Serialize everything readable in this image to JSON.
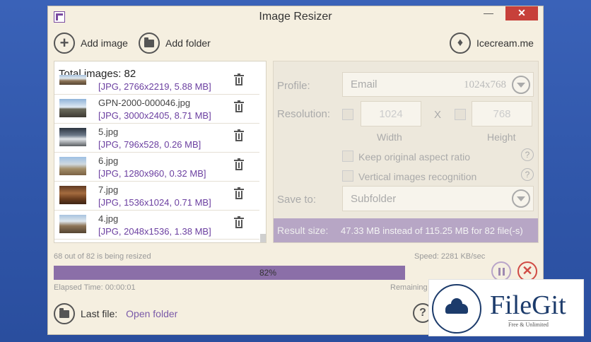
{
  "window": {
    "title": "Image Resizer",
    "minimize_glyph": "—",
    "close_glyph": "✕"
  },
  "toolbar": {
    "add_image": "Add image",
    "add_folder": "Add folder",
    "icecream": "Icecream.me"
  },
  "list": {
    "total": "Total images: 82",
    "items": [
      {
        "name": "",
        "meta": "[JPG, 2766x2219, 5.88 MB]"
      },
      {
        "name": "GPN-2000-000046.jpg",
        "meta": "[JPG, 3000x2405, 8.71 MB]"
      },
      {
        "name": "5.jpg",
        "meta": "[JPG, 796x528, 0.26 MB]"
      },
      {
        "name": "6.jpg",
        "meta": "[JPG, 1280x960, 0.32 MB]"
      },
      {
        "name": "7.jpg",
        "meta": "[JPG, 1536x1024, 0.71 MB]"
      },
      {
        "name": "4.jpg",
        "meta": "[JPG, 2048x1536, 1.38 MB]"
      }
    ]
  },
  "settings": {
    "profile_label": "Profile:",
    "profile_value": "Email",
    "profile_dims": "1024x768",
    "resolution_label": "Resolution:",
    "width_value": "1024",
    "height_value": "768",
    "x_label": "X",
    "width_label": "Width",
    "height_label": "Height",
    "keep_aspect": "Keep original aspect ratio",
    "vertical_recognition": "Vertical images recognition",
    "help_glyph": "?",
    "save_to_label": "Save to:",
    "save_to_value": "Subfolder",
    "result_label": "Result size:",
    "result_value": "47.33 MB instead of 115.25 MB for 82 file(-s)"
  },
  "status": {
    "resizing": "68 out of 82 is being resized",
    "speed": "Speed: 2281 KB/sec",
    "progress_percent": 82,
    "progress_label": "82%",
    "elapsed": "Elapsed Time: 00:00:01",
    "remaining": "Remaining"
  },
  "footer": {
    "last_file": "Last file:",
    "open_folder": "Open folder",
    "help_glyph": "?"
  },
  "watermark": {
    "name": "FileGit",
    "tagline": "Free & Unlimited"
  }
}
